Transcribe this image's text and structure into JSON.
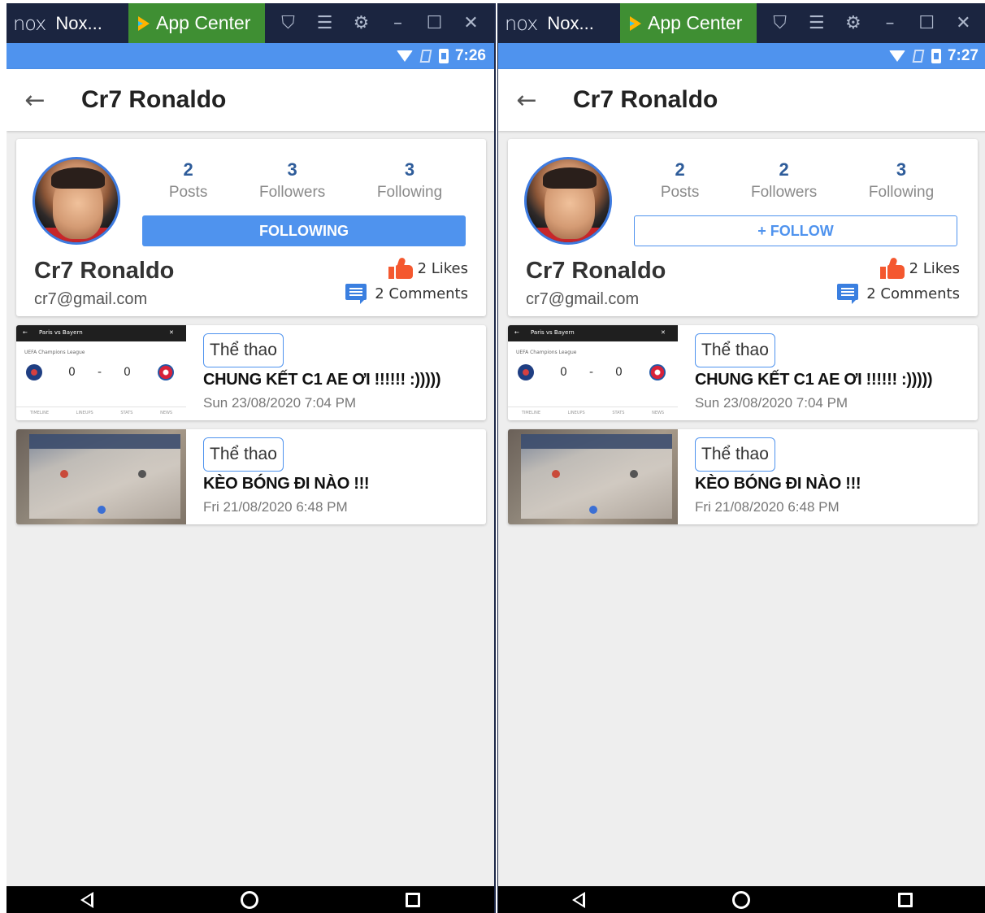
{
  "panels": [
    {
      "titlebar": {
        "nox_logo": "nox",
        "app_name": "Nox...",
        "app_center": "App Center"
      },
      "status": {
        "time": "7:26"
      },
      "appbar": {
        "title": "Cr7 Ronaldo"
      },
      "profile": {
        "name": "Cr7 Ronaldo",
        "email": "cr7@gmail.com",
        "stats": [
          {
            "value": "2",
            "label": "Posts"
          },
          {
            "value": "3",
            "label": "Followers"
          },
          {
            "value": "3",
            "label": "Following"
          }
        ],
        "follow_button": "FOLLOWING",
        "likes": "2 Likes",
        "comments": "2 Comments"
      },
      "posts": [
        {
          "tag": "Thể thao",
          "title": "CHUNG KẾT C1 AE ƠI !!!!!! :)))))",
          "date": "Sun 23/08/2020 7:04 PM"
        },
        {
          "tag": "Thể thao",
          "title": "KÈO BÓNG ĐI NÀO !!!",
          "date": "Fri 21/08/2020 6:48 PM"
        }
      ]
    },
    {
      "titlebar": {
        "nox_logo": "nox",
        "app_name": "Nox...",
        "app_center": "App Center"
      },
      "status": {
        "time": "7:27"
      },
      "appbar": {
        "title": "Cr7 Ronaldo"
      },
      "profile": {
        "name": "Cr7 Ronaldo",
        "email": "cr7@gmail.com",
        "stats": [
          {
            "value": "2",
            "label": "Posts"
          },
          {
            "value": "2",
            "label": "Followers"
          },
          {
            "value": "3",
            "label": "Following"
          }
        ],
        "follow_button": "+ FOLLOW",
        "likes": "2 Likes",
        "comments": "2 Comments"
      },
      "posts": [
        {
          "tag": "Thể thao",
          "title": "CHUNG KẾT C1 AE ƠI !!!!!! :)))))",
          "date": "Sun 23/08/2020 7:04 PM"
        },
        {
          "tag": "Thể thao",
          "title": "KÈO BÓNG ĐI NÀO !!!",
          "date": "Fri 21/08/2020 6:48 PM"
        }
      ]
    }
  ],
  "thumbnail_text": {
    "match": "Paris vs Bayern",
    "league": "UEFA Champions League",
    "score_home": "0",
    "score_sep": "-",
    "score_away": "0",
    "tabs": [
      "TIMELINE",
      "LINEUPS",
      "STATS",
      "NEWS"
    ]
  },
  "colors": {
    "status_bar": "#4f93ee",
    "accent": "#4f93ee",
    "like_icon": "#f4582f",
    "comment_icon": "#3a7fe0",
    "stat_number": "#2e5c9a",
    "app_center": "#3f8f33",
    "nox_titlebar": "#1b2540"
  },
  "icons": {
    "back": "arrow-left-icon",
    "like": "thumbs-up-icon",
    "comment": "comment-icon",
    "wifi": "wifi-icon",
    "battery": "battery-icon"
  }
}
